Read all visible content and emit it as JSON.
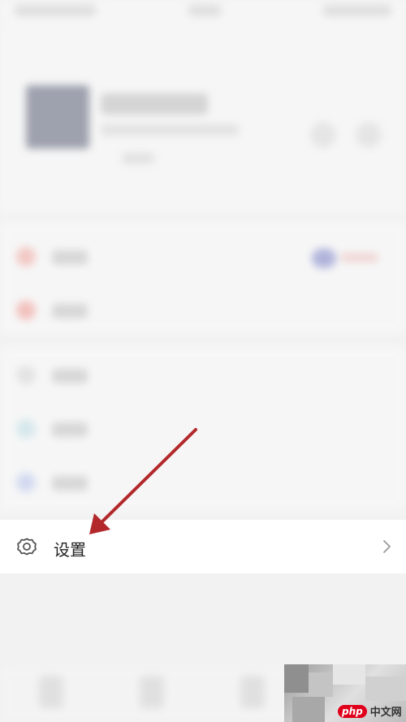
{
  "settings_row": {
    "label": "设置",
    "icon": "gear-icon",
    "chevron": "chevron-right-icon"
  },
  "annotation": {
    "arrow_color": "#b3282b"
  },
  "watermark": {
    "badge": "php",
    "text": "中文网"
  },
  "colors": {
    "page_background": "#f2f2f2",
    "row_background": "#ffffff",
    "text": "#222222",
    "icon": "#555555"
  }
}
